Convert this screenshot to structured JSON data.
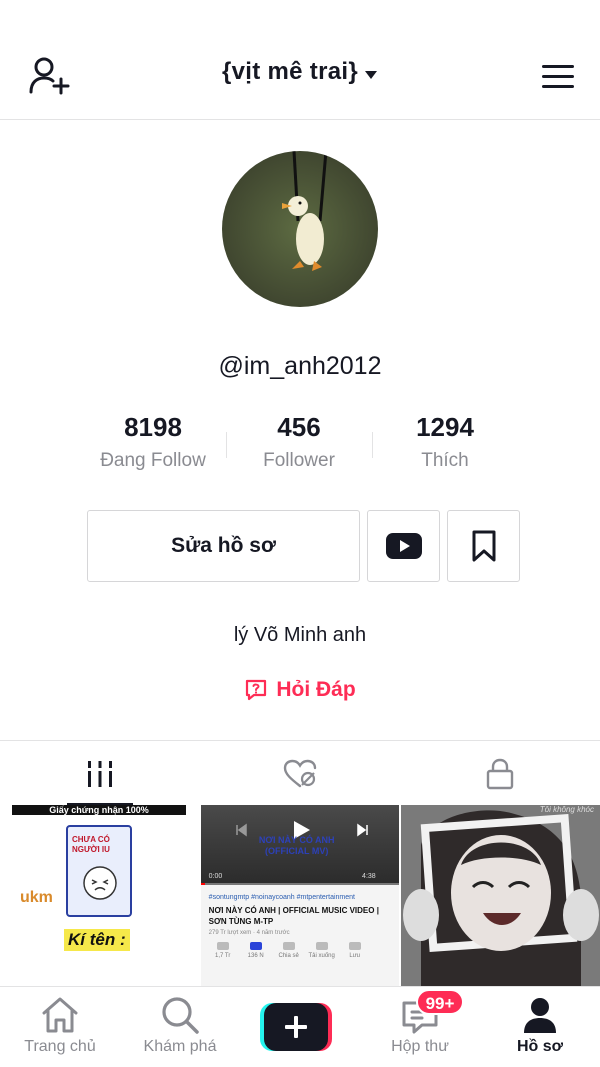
{
  "header": {
    "title": "{vịt mê trai}",
    "add_user_icon": "add-user-icon",
    "menu_icon": "hamburger-menu-icon"
  },
  "profile": {
    "handle": "@im_anh2012",
    "avatar_description_icon": "avatar-duck-image",
    "stats": [
      {
        "value": "8198",
        "label": "Đang Follow"
      },
      {
        "value": "456",
        "label": "Follower"
      },
      {
        "value": "1294",
        "label": "Thích"
      }
    ],
    "edit_button": "Sửa hồ sơ",
    "bio": "lý Võ Minh anh",
    "qa_link": "Hỏi Đáp"
  },
  "tabs": [
    {
      "name": "videos",
      "icon": "grid-icon",
      "active": true
    },
    {
      "name": "liked",
      "icon": "hidden-heart-icon",
      "active": false
    },
    {
      "name": "private",
      "icon": "lock-icon",
      "active": false
    }
  ],
  "thumbnails": {
    "t1": {
      "banner": "Giấy chứng nhận 100%",
      "card_text": "CHƯA CÓ NGƯỜI IU",
      "ukm": "ukm",
      "kiten": "Kí tên :"
    },
    "t2": {
      "overlay_text": "NƠI NÀY CÓ ANH (OFFICIAL MV)",
      "time_start": "0:00",
      "time_end": "4:38",
      "tags": "#sontungmtp #noinaycoanh #mtpentertainment",
      "title": "NƠI NÀY CÓ ANH | OFFICIAL MUSIC VIDEO | SƠN TÙNG M-TP",
      "meta": "279 Tr lượt xem · 4 năm trước",
      "actions": [
        "1,7 Tr",
        "136 N",
        "Chia sẻ",
        "Tải xuống",
        "Lưu"
      ]
    },
    "t3": {
      "caption": "Tôi không khóc"
    }
  },
  "bottom_nav": [
    {
      "label": "Trang chủ",
      "icon": "home-icon"
    },
    {
      "label": "Khám phá",
      "icon": "search-icon"
    },
    {
      "label": "",
      "icon": "create-plus-icon"
    },
    {
      "label": "Hộp thư",
      "icon": "inbox-icon",
      "badge": "99+"
    },
    {
      "label": "Hồ sơ",
      "icon": "profile-icon",
      "active": true
    }
  ],
  "colors": {
    "accent": "#fe2c55",
    "text": "#161823",
    "muted": "#8a8b91",
    "border": "#e3e3e4"
  }
}
